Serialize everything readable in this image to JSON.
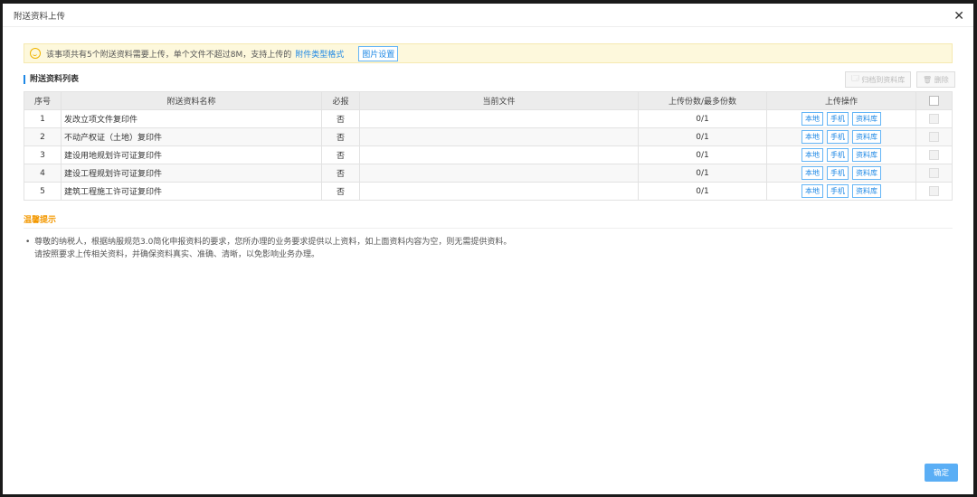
{
  "title": "附送资料上传",
  "notice": {
    "text": "该事项共有5个附送资料需要上传，单个文件不超过8M，支持上传的",
    "link": "附件类型格式",
    "button": "图片设置"
  },
  "section_title": "附送资料列表",
  "toolbar": {
    "archive": "归档到资料库",
    "delete": "删除"
  },
  "table": {
    "headers": [
      "序号",
      "附送资料名称",
      "必报",
      "当前文件",
      "上传份数/最多份数",
      "上传操作"
    ],
    "rows": [
      {
        "no": "1",
        "name": "发改立项文件复印件",
        "required": "否",
        "file": "",
        "count": "0/1"
      },
      {
        "no": "2",
        "name": "不动产权证（土地）复印件",
        "required": "否",
        "file": "",
        "count": "0/1"
      },
      {
        "no": "3",
        "name": "建设用地规划许可证复印件",
        "required": "否",
        "file": "",
        "count": "0/1"
      },
      {
        "no": "4",
        "name": "建设工程规划许可证复印件",
        "required": "否",
        "file": "",
        "count": "0/1"
      },
      {
        "no": "5",
        "name": "建筑工程施工许可证复印件",
        "required": "否",
        "file": "",
        "count": "0/1"
      }
    ],
    "ops": [
      "本地",
      "手机",
      "资料库"
    ]
  },
  "tips": {
    "title": "温馨提示",
    "line1": "尊敬的纳税人，根据纳服规范3.0简化申报资料的要求，您所办理的业务要求提供以上资料，如上面资料内容为空，则无需提供资料。",
    "line2": "请按照要求上传相关资料，并确保资料真实、准确、清晰，以免影响业务办理。"
  },
  "confirm": "确定"
}
